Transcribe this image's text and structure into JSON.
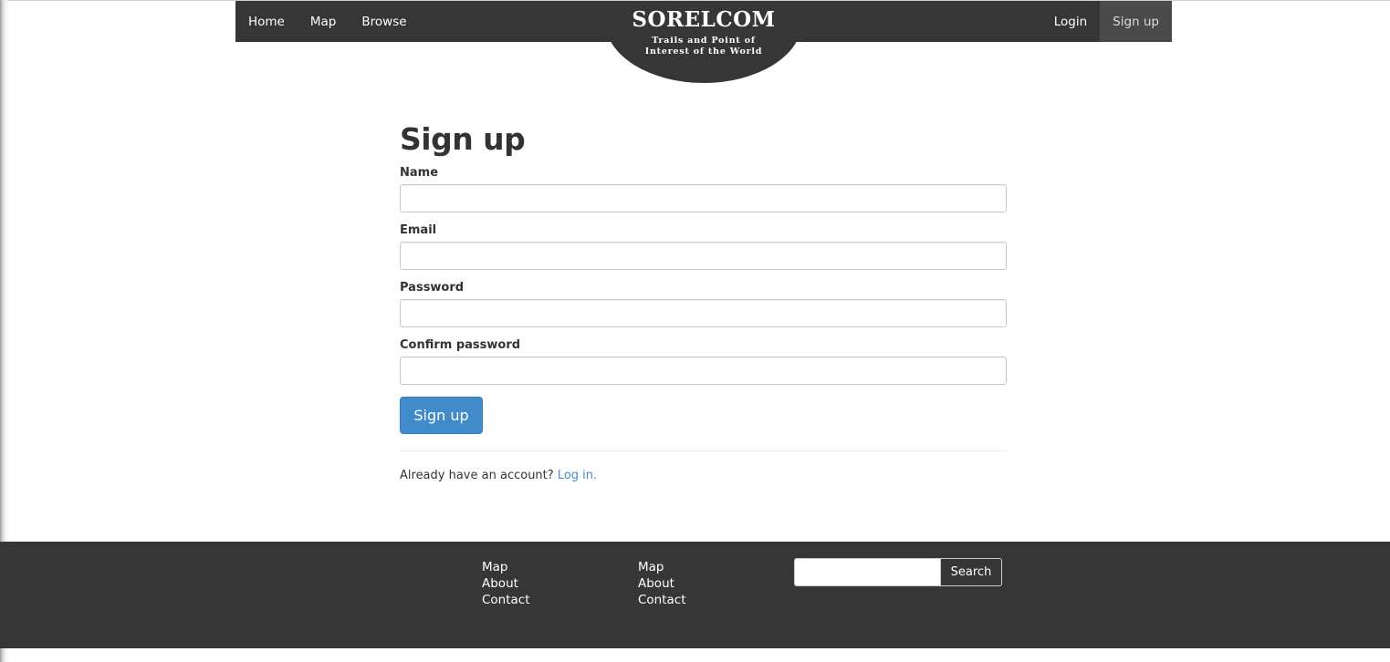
{
  "navbar": {
    "left_items": [
      {
        "label": "Home"
      },
      {
        "label": "Map"
      },
      {
        "label": "Browse"
      }
    ],
    "right_items": [
      {
        "label": "Login",
        "active": false
      },
      {
        "label": "Sign up",
        "active": true
      }
    ]
  },
  "brand": {
    "title": "SORELCOM",
    "tagline": "Trails and Point of Interest of the World"
  },
  "form": {
    "title": "Sign up",
    "fields": [
      {
        "label": "Name",
        "value": "",
        "placeholder": ""
      },
      {
        "label": "Email",
        "value": "",
        "placeholder": ""
      },
      {
        "label": "Password",
        "value": "",
        "placeholder": ""
      },
      {
        "label": "Confirm password",
        "value": "",
        "placeholder": ""
      }
    ],
    "submit_label": "Sign up",
    "login_prompt": "Already have an account?",
    "login_link": "Log in."
  },
  "footer": {
    "column1": [
      "Map",
      "About",
      "Contact"
    ],
    "column2": [
      "Map",
      "About",
      "Contact"
    ],
    "search": {
      "placeholder": "",
      "button_label": "Search"
    }
  },
  "colors": {
    "nav_background": "#363636",
    "active_nav": "#4a4a4a",
    "primary_button": "#428bca",
    "link": "#428bca"
  }
}
